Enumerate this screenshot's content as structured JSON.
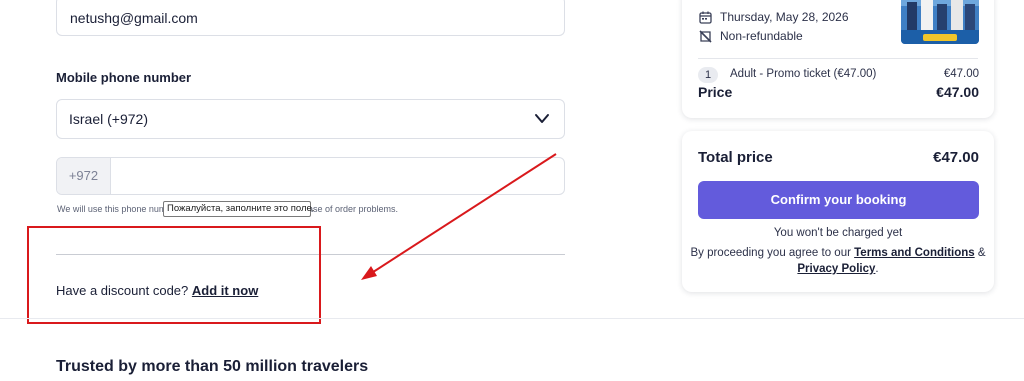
{
  "contact": {
    "email_value": "netushg@gmail.com",
    "phone_label": "Mobile phone number",
    "country_value": "Israel (+972)",
    "phone_prefix": "+972",
    "phone_value": "",
    "phone_hint": "We will use this phone number to contact you via SMS and in case of order problems.",
    "validation_tooltip": "Пожалуйста, заполните это поле."
  },
  "discount": {
    "prompt": "Have a discount code? ",
    "link_label": "Add it now"
  },
  "footer": {
    "trusted_heading": "Trusted by more than 50 million travelers"
  },
  "summary": {
    "date": "Thursday, May 28, 2026",
    "refund_policy": "Non-refundable",
    "ticket_qty": "1",
    "ticket_name": "Adult - Promo ticket  (€47.00)",
    "ticket_price": "€47.00",
    "price_label": "Price",
    "price_value": "€47.00"
  },
  "checkout": {
    "total_label": "Total price",
    "total_value": "€47.00",
    "confirm_label": "Confirm your booking",
    "not_charged": "You won't be charged yet",
    "agree_prefix": "By proceeding you agree to our ",
    "terms_link": "Terms and Conditions",
    "agree_join": " & ",
    "privacy_link": "Privacy Policy",
    "agree_suffix": "."
  },
  "icons": {
    "date": "calendar-icon",
    "refund": "no-refund-icon",
    "country": "chevron-down-icon"
  },
  "colors": {
    "accent": "#635bdc",
    "annotation": "#d9191c"
  }
}
